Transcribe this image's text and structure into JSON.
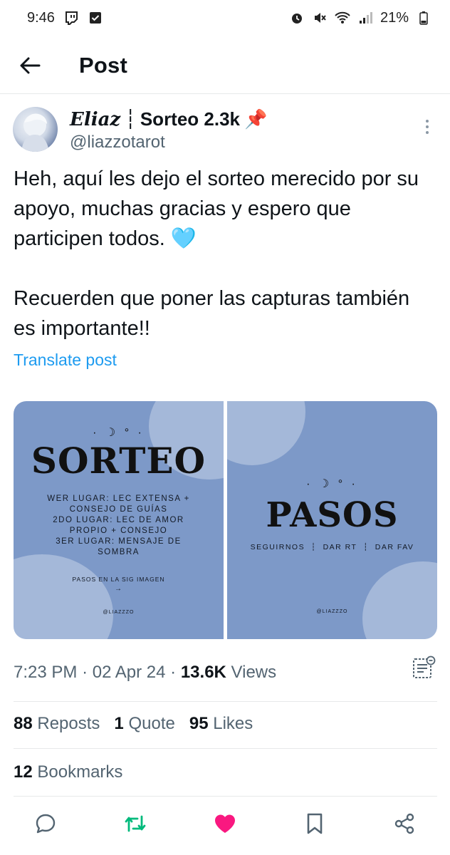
{
  "status_bar": {
    "time": "9:46",
    "battery": "21%",
    "icons": [
      "twitch-icon",
      "check-box-icon",
      "alarm-icon",
      "mute-icon",
      "wifi-icon",
      "signal-icon",
      "battery-icon"
    ]
  },
  "header": {
    "title": "Post",
    "back_icon": "arrow-left-icon"
  },
  "post": {
    "author": {
      "name_script": "Eliaz",
      "name_separator": "┆",
      "name_rest": "Sorteo 2.3k",
      "name_emoji": "📌",
      "handle": "@liazzotarot"
    },
    "text": "Heh, aquí les dejo el sorteo merecido por su apoyo, muchas gracias y espero que participen todos. 🩵\n\nRecuerden que poner las capturas también es importante!!",
    "translate_label": "Translate post",
    "media": [
      {
        "moon": "· ☽ ° ·",
        "title": "SORTEO",
        "lines": [
          "WER LUGAR: LEC EXTENSA +",
          "CONSEJO DE GUÍAS",
          "2DO LUGAR: LEC DE AMOR",
          "PROPIO + CONSEJO",
          "3ER LUGAR: MENSAJE DE",
          "SOMBRA"
        ],
        "footer": "PASOS EN LA SIG IMAGEN",
        "arrow": "→",
        "credit": "@LIAZZZO"
      },
      {
        "moon": "· ☽ ° ·",
        "title": "PASOS",
        "steps": "SEGUIRNOS  ┆  DAR RT  ┆  DAR FAV",
        "credit": "@LIAZZZO"
      }
    ],
    "meta": {
      "time": "7:23 PM",
      "dot": "·",
      "date": "02 Apr 24",
      "views_count": "13.6K",
      "views_label": "Views"
    },
    "stats": {
      "reposts_count": "88",
      "reposts_label": "Reposts",
      "quotes_count": "1",
      "quotes_label": "Quote",
      "likes_count": "95",
      "likes_label": "Likes",
      "bookmarks_count": "12",
      "bookmarks_label": "Bookmarks"
    },
    "actions": [
      "reply-icon",
      "repost-icon",
      "like-icon",
      "bookmark-icon",
      "share-icon"
    ]
  },
  "colors": {
    "accent": "#1d9bf0",
    "repost": "#00ba7c",
    "like": "#f91880",
    "muted": "#536471",
    "media_bg": "#7d99c8"
  }
}
